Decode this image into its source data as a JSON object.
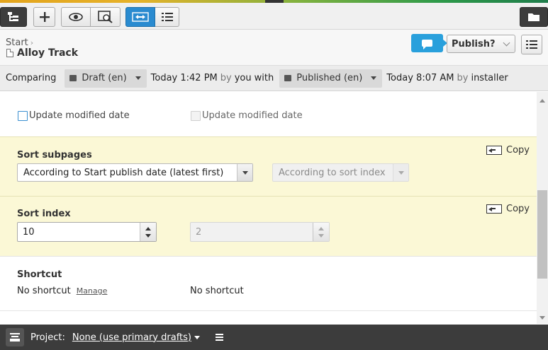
{
  "toolbar": {
    "buttons": [
      {
        "icon": "site-tree-icon",
        "active": true
      },
      {
        "icon": "plus-icon"
      },
      {
        "icon": "eye-icon"
      },
      {
        "icon": "preview-zoom-icon"
      },
      {
        "icon": "compare-arrows-icon",
        "active": true
      },
      {
        "icon": "list-view-icon"
      },
      {
        "icon": "folder-icon"
      }
    ]
  },
  "header": {
    "breadcrumb": "Start",
    "page_title": "Alloy Track",
    "publish_label": "Publish?",
    "colors": {
      "comment": "#29a0dc"
    }
  },
  "compare": {
    "label": "Comparing",
    "left_version": "Draft (en)",
    "left_time": "Today 1:42 PM",
    "by1": "by",
    "left_user": "you",
    "with": "with",
    "right_version": "Published (en)",
    "right_time": "Today 8:07 AM",
    "by2": "by",
    "right_user": "installer"
  },
  "fields": {
    "update_modified": {
      "label_left": "Update modified date",
      "label_right": "Update modified date"
    },
    "sort_subpages": {
      "title": "Sort subpages",
      "copy_label": "Copy",
      "left_value": "According to Start publish date (latest first)",
      "right_value": "According to sort index"
    },
    "sort_index": {
      "title": "Sort index",
      "copy_label": "Copy",
      "left_value": "10",
      "right_value": "2"
    },
    "shortcut": {
      "title": "Shortcut",
      "left_value": "No shortcut",
      "manage_label": "Manage",
      "right_value": "No shortcut"
    }
  },
  "footer": {
    "project_label": "Project:",
    "project_value": "None (use primary drafts)"
  }
}
